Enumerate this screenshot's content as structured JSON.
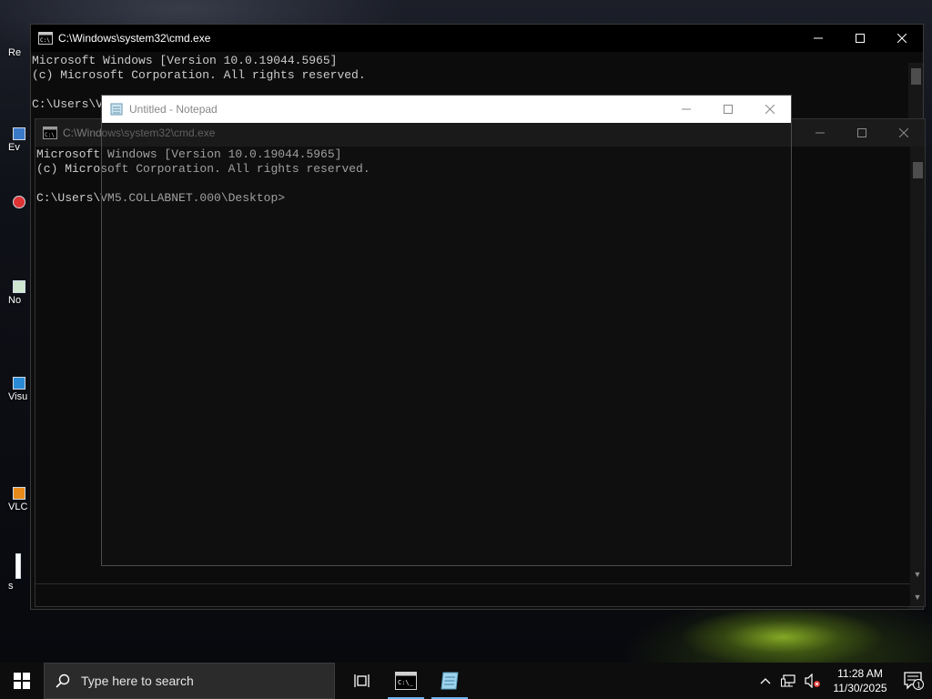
{
  "desktop": {
    "icons": [
      {
        "label": "Re"
      },
      {
        "label": "Ev"
      },
      {
        "label": ""
      },
      {
        "label": "No"
      },
      {
        "label": "Visu"
      },
      {
        "label": "VLC"
      },
      {
        "label": "s"
      }
    ]
  },
  "cmd_back": {
    "title": "C:\\Windows\\system32\\cmd.exe",
    "lines": [
      "Microsoft Windows [Version 10.0.19044.5965]",
      "(c) Microsoft Corporation. All rights reserved.",
      "",
      "C:\\Users\\V"
    ]
  },
  "notepad": {
    "title": "Untitled - Notepad"
  },
  "cmd_front": {
    "title": "C:\\Windows\\system32\\cmd.exe",
    "lines": [
      "Microsoft Windows [Version 10.0.19044.5965]",
      "(c) Microsoft Corporation. All rights reserved.",
      "",
      "C:\\Users\\VM5.COLLABNET.000\\Desktop>"
    ]
  },
  "taskbar": {
    "search_placeholder": "Type here to search",
    "time": "11:28 AM",
    "date": "11/30/2025",
    "notification_count": "1"
  },
  "colors": {
    "console_bg": "#0c0c0c",
    "console_text": "#cccccc",
    "taskbar_bg": "#0d0d0d",
    "accent": "#6fb3f0"
  }
}
